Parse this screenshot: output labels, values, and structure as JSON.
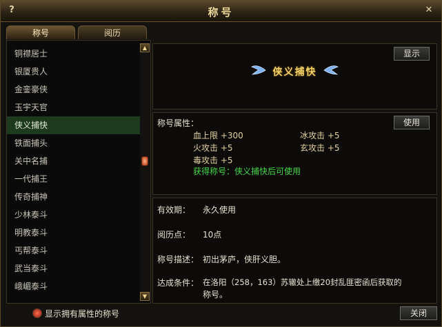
{
  "window": {
    "title": "称号",
    "help_glyph": "?",
    "close_glyph": "✕"
  },
  "tabs": [
    {
      "label": "称号"
    },
    {
      "label": "阅历"
    }
  ],
  "list": {
    "items": [
      {
        "label": "铜襟居士"
      },
      {
        "label": "银厦贵人"
      },
      {
        "label": "金銮豪侠"
      },
      {
        "label": "玉宇天官"
      },
      {
        "label": "侠义捕快"
      },
      {
        "label": "铁面捕头"
      },
      {
        "label": "关中名捕"
      },
      {
        "label": "一代捕王"
      },
      {
        "label": "传奇捕神"
      },
      {
        "label": "少林泰斗"
      },
      {
        "label": "明教泰斗"
      },
      {
        "label": "丐帮泰斗"
      },
      {
        "label": "武当泰斗"
      },
      {
        "label": "峨嵋泰斗"
      }
    ],
    "selected": "侠义捕快"
  },
  "preview": {
    "show_button": "显示",
    "badge_text": "侠义捕快"
  },
  "attributes": {
    "heading": "称号属性：",
    "use_button": "使用",
    "blood": "血上限 +300",
    "ice": "冰攻击 +5",
    "fire": "火攻击 +5",
    "mystic": "玄攻击 +5",
    "poison": "毒攻击 +5",
    "obtain": "获得称号：侠义捕快后可使用"
  },
  "details": {
    "validity_label": "有效期：",
    "validity_value": "永久使用",
    "points_label": "阅历点：",
    "points_value": "10点",
    "desc_label": "称号描述：",
    "desc_value": "初出茅庐，侠肝义胆。",
    "cond_label": "达成条件：",
    "cond_line1": "在洛阳（258，163）苏辙处上缴20封乱匪密函后获取的",
    "cond_line2": "称号。"
  },
  "footer": {
    "filter_label": "显示拥有属性的称号",
    "close_button": "关闭"
  },
  "colors": {
    "selected_row": "#1e3a1e",
    "gold_text": "#f2d46a",
    "green_text": "#46d846"
  }
}
